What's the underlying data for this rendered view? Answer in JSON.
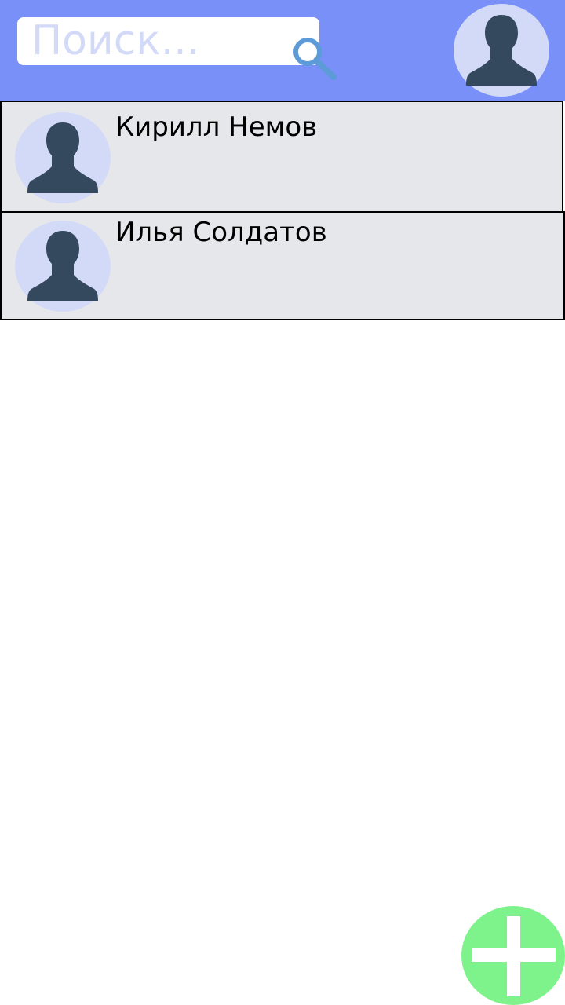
{
  "search": {
    "placeholder": "Поиск...",
    "icon": "search-icon"
  },
  "profile": {
    "icon": "user-avatar-icon"
  },
  "contacts": [
    {
      "name": "Кирилл Немов",
      "icon": "user-avatar-icon"
    },
    {
      "name": "Илья Солдатов",
      "icon": "user-avatar-icon"
    }
  ],
  "fab": {
    "icon": "plus-icon"
  },
  "colors": {
    "header": "#7890f8",
    "row_background": "#e6e7ea",
    "avatar_circle": "#d3daf8",
    "avatar_silhouette": "#34495e",
    "search_icon": "#5d9ad8",
    "fab": "#7ef38c"
  }
}
